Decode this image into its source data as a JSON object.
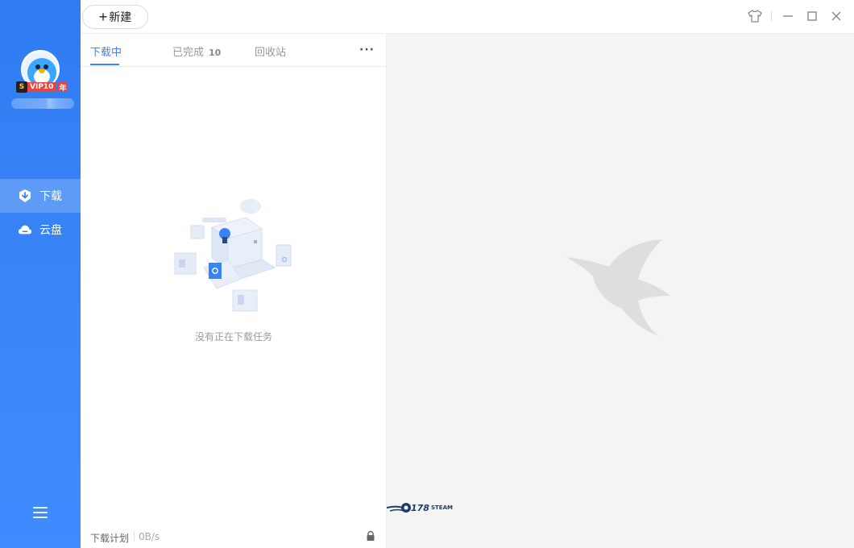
{
  "sidebar": {
    "vip": {
      "s": "S",
      "text": "VIP10",
      "year": "年"
    },
    "nav": [
      {
        "label": "下载",
        "icon": "download-shield-icon",
        "active": true
      },
      {
        "label": "云盘",
        "icon": "cloud-icon",
        "active": false
      }
    ],
    "menu_icon": "hamburger-menu-icon"
  },
  "topbar": {
    "new_label": "新建",
    "window_controls": [
      "skin-icon",
      "minimize-icon",
      "maximize-icon",
      "close-icon"
    ]
  },
  "panel": {
    "tabs": [
      {
        "label": "下载中",
        "active": true
      },
      {
        "label": "已完成",
        "count": "10"
      },
      {
        "label": "回收站"
      }
    ],
    "more": "···",
    "empty_text": "没有正在下载任务",
    "footer": {
      "plan_label": "下载计划",
      "speed": "0B/s"
    }
  },
  "brand": {
    "number": "178",
    "word": "STEAM"
  },
  "colors": {
    "sidebar": "#3b86f6",
    "accent": "#3a83f4",
    "right_bg": "#f4f4f4"
  }
}
